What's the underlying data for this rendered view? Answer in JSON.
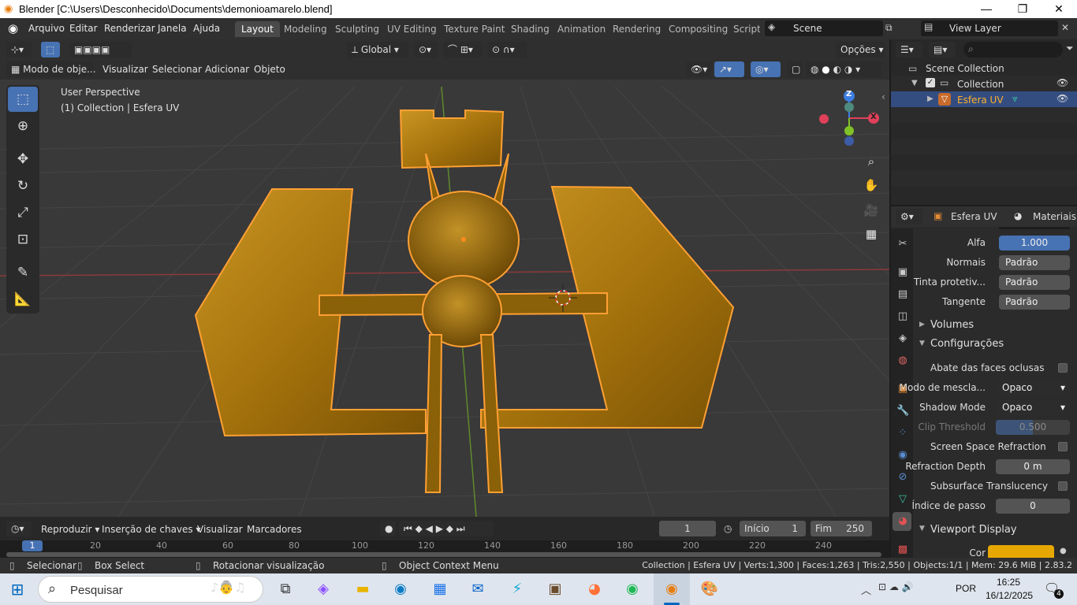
{
  "window": {
    "title": "Blender [C:\\Users\\Desconhecido\\Documents\\demonioamarelo.blend]",
    "minimize": "—",
    "maximize": "❐",
    "close": "✕"
  },
  "menu": {
    "items": [
      "Arquivo",
      "Editar",
      "Renderizar",
      "Janela",
      "Ajuda"
    ]
  },
  "workspaces": [
    "Layout",
    "Modeling",
    "Sculpting",
    "UV Editing",
    "Texture Paint",
    "Shading",
    "Animation",
    "Rendering",
    "Compositing",
    "Scripti"
  ],
  "scene": {
    "name": "Scene",
    "view_layer": "View Layer"
  },
  "viewport": {
    "transform_orientation": "Global",
    "options": "Opções",
    "mode": "Modo de obje...",
    "menus": [
      "Visualizar",
      "Selecionar",
      "Adicionar",
      "Objeto"
    ],
    "perspective": "User Perspective",
    "collection_info": "(1) Collection | Esfera UV",
    "gizmo": {
      "z": "Z",
      "x": "X",
      "y": "Y"
    }
  },
  "timeline": {
    "play_menu": "Reproduzir",
    "keying_menu": "Inserção de chaves",
    "view_menu": "Visualizar",
    "markers_menu": "Marcadores",
    "current_frame": "1",
    "start_label": "Início",
    "start": "1",
    "end_label": "Fim",
    "end": "250",
    "ruler": [
      "1",
      "20",
      "40",
      "60",
      "80",
      "100",
      "120",
      "140",
      "160",
      "180",
      "200",
      "220",
      "240"
    ]
  },
  "status": {
    "select": "Selecionar",
    "box_select": "Box Select",
    "rotate": "Rotacionar visualização",
    "context_menu": "Object Context Menu",
    "stats": "Collection | Esfera UV | Verts:1,300 | Faces:1,263 | Tris:2,550 | Objects:1/1 | Mem: 29.6 MiB | 2.83.2"
  },
  "outliner": {
    "scene_collection": "Scene Collection",
    "collection": "Collection",
    "object": "Esfera UV"
  },
  "properties": {
    "object_name": "Esfera UV",
    "tab": "Materiais",
    "rows": [
      {
        "label": "Alfa",
        "value": "1.000"
      },
      {
        "label": "Normais",
        "value": "Padrão"
      },
      {
        "label": "Tinta protetiv...",
        "value": "Padrão"
      },
      {
        "label": "Tangente",
        "value": "Padrão"
      }
    ],
    "volumes": "Volumes",
    "settings": "Configurações",
    "backface": "Abate das faces oclusas",
    "blend_label": "Modo de mescla...",
    "blend_value": "Opaco",
    "shadow_label": "Shadow Mode",
    "shadow_value": "Opaco",
    "clip_label": "Clip Threshold",
    "clip_value": "0.500",
    "ssr": "Screen Space Refraction",
    "refr_label": "Refraction Depth",
    "refr_value": "0 m",
    "sss": "Subsurface Translucency",
    "pass_label": "Índice de passo",
    "pass_value": "0",
    "viewport_display": "Viewport Display",
    "color_label": "Cor"
  },
  "taskbar": {
    "search": "Pesquisar",
    "lang": "POR",
    "time": "16:25",
    "date": "16/12/2025",
    "notif": "4"
  },
  "colors": {
    "accent": "#4772b3",
    "selection_outline": "#f5901f",
    "material_color": "#e6a800",
    "object_highlight": "#ffa033"
  }
}
